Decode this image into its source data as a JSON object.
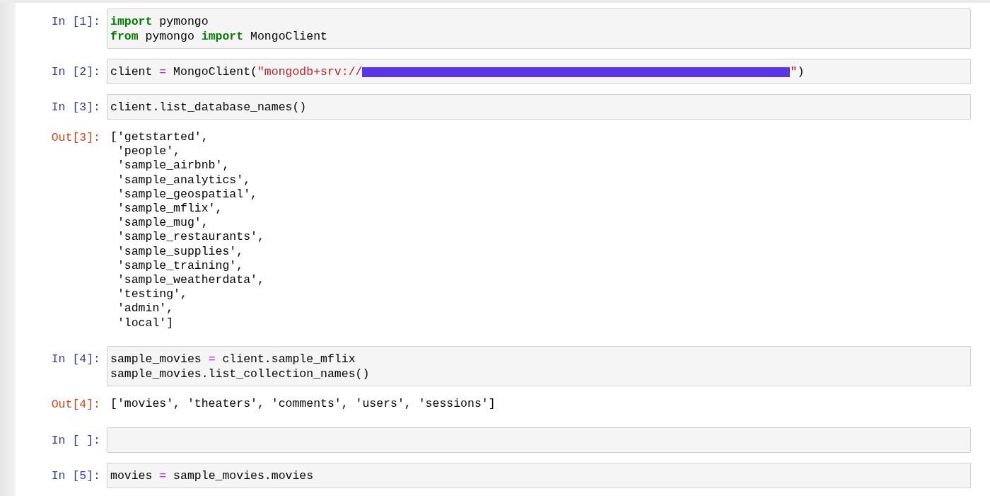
{
  "cells": [
    {
      "kind": "input",
      "prompt": "In [1]:",
      "lines": [
        [
          {
            "kind": "keyword",
            "text": "import"
          },
          {
            "kind": "plain",
            "text": " pymongo"
          }
        ],
        [
          {
            "kind": "keyword",
            "text": "from"
          },
          {
            "kind": "plain",
            "text": " pymongo "
          },
          {
            "kind": "keyword",
            "text": "import"
          },
          {
            "kind": "plain",
            "text": " MongoClient"
          }
        ]
      ]
    },
    {
      "kind": "input",
      "prompt": "In [2]:",
      "lines": [
        [
          {
            "kind": "plain",
            "text": "client "
          },
          {
            "kind": "operator",
            "text": "="
          },
          {
            "kind": "plain",
            "text": " MongoClient("
          },
          {
            "kind": "string",
            "text": "\"mongodb+srv://"
          },
          {
            "kind": "redaction"
          },
          {
            "kind": "string",
            "text": "\""
          },
          {
            "kind": "plain",
            "text": ")"
          }
        ]
      ]
    },
    {
      "kind": "input",
      "prompt": "In [3]:",
      "lines": [
        [
          {
            "kind": "plain",
            "text": "client.list_database_names()"
          }
        ]
      ]
    },
    {
      "kind": "output",
      "prompt": "Out[3]:",
      "lines": [
        "['getstarted',",
        " 'people',",
        " 'sample_airbnb',",
        " 'sample_analytics',",
        " 'sample_geospatial',",
        " 'sample_mflix',",
        " 'sample_mug',",
        " 'sample_restaurants',",
        " 'sample_supplies',",
        " 'sample_training',",
        " 'sample_weatherdata',",
        " 'testing',",
        " 'admin',",
        " 'local']"
      ]
    },
    {
      "kind": "input",
      "prompt": "In [4]:",
      "lines": [
        [
          {
            "kind": "plain",
            "text": "sample_movies "
          },
          {
            "kind": "operator",
            "text": "="
          },
          {
            "kind": "plain",
            "text": " client.sample_mflix"
          }
        ],
        [
          {
            "kind": "plain",
            "text": "sample_movies.list_collection_names()"
          }
        ]
      ]
    },
    {
      "kind": "output",
      "prompt": "Out[4]:",
      "lines": [
        "['movies', 'theaters', 'comments', 'users', 'sessions']"
      ]
    },
    {
      "kind": "input",
      "prompt": "In [ ]:"
    },
    {
      "kind": "input",
      "prompt": "In [5]:",
      "lines": [
        [
          {
            "kind": "plain",
            "text": "movies "
          },
          {
            "kind": "operator",
            "text": "="
          },
          {
            "kind": "plain",
            "text": " sample_movies.movies"
          }
        ]
      ]
    }
  ]
}
